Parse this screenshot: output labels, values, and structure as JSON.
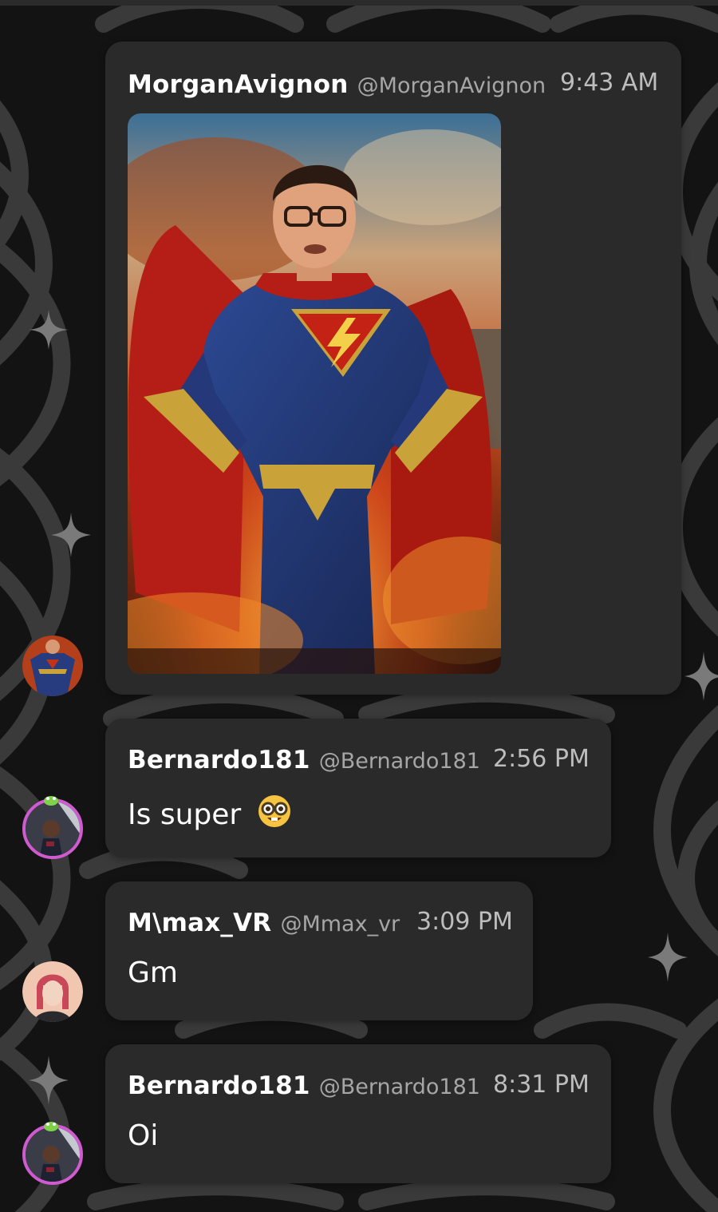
{
  "messages": [
    {
      "author": "MorganAvignon",
      "handle": "@MorganAvignon",
      "time": "9:43 AM",
      "attachment": "image",
      "avatar": "superhero-avatar"
    },
    {
      "author": "Bernardo181",
      "handle": "@Bernardo181",
      "time": "2:56 PM",
      "text": "Is super",
      "emoji": "nerd-face",
      "avatar": "bernardo-avatar"
    },
    {
      "author": "M\\max_VR",
      "handle": "@Mmax_vr",
      "time": "3:09 PM",
      "text": "Gm",
      "avatar": "mmax-avatar"
    },
    {
      "author": "Bernardo181",
      "handle": "@Bernardo181",
      "time": "8:31 PM",
      "text": "Oi",
      "avatar": "bernardo-avatar"
    }
  ],
  "theme": {
    "card_bg": "#2a2a2a",
    "avatar_ring": "#d05ad0",
    "background": "#141414"
  }
}
